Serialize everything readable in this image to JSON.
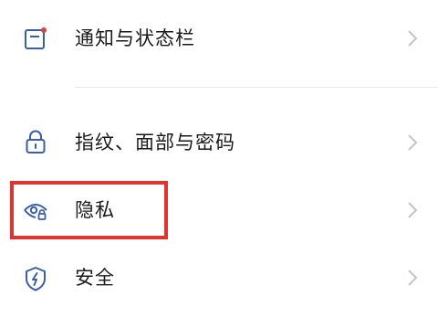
{
  "settings": {
    "items": [
      {
        "label": "通知与状态栏",
        "icon": "notification-bar-icon"
      },
      {
        "label": "指纹、面部与密码",
        "icon": "lock-icon"
      },
      {
        "label": "隐私",
        "icon": "privacy-eye-icon"
      },
      {
        "label": "安全",
        "icon": "security-shield-icon"
      }
    ]
  },
  "colors": {
    "icon_blue": "#3b5ea8",
    "notification_dot": "#e0403a",
    "highlight": "#e0352f",
    "chevron": "#c4c4c4",
    "text": "#1a1a1a",
    "divider": "#e8e8e8"
  }
}
